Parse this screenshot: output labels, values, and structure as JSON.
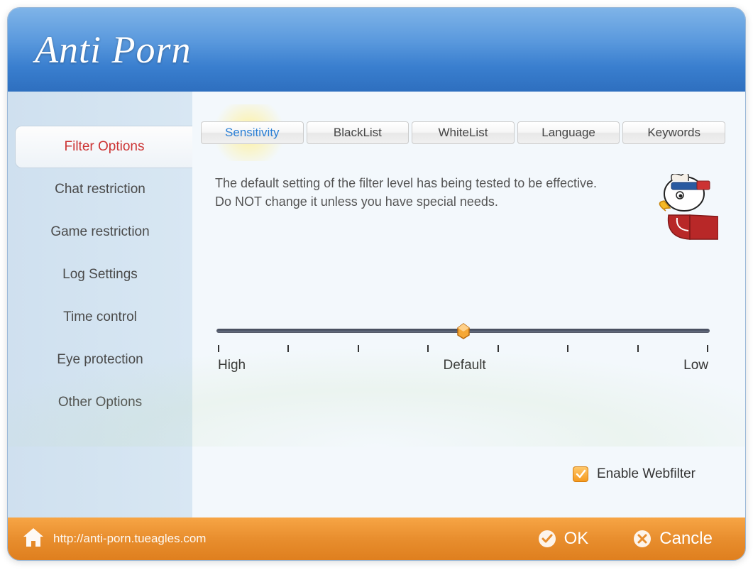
{
  "app": {
    "title": "Anti Porn"
  },
  "sidebar": {
    "items": [
      {
        "label": "Filter Options",
        "active": true
      },
      {
        "label": "Chat restriction",
        "active": false
      },
      {
        "label": "Game restriction",
        "active": false
      },
      {
        "label": "Log Settings",
        "active": false
      },
      {
        "label": "Time control",
        "active": false
      },
      {
        "label": "Eye protection",
        "active": false
      },
      {
        "label": "Other Options",
        "active": false
      }
    ]
  },
  "tabs": [
    {
      "label": "Sensitivity",
      "active": true
    },
    {
      "label": "BlackList",
      "active": false
    },
    {
      "label": "WhiteList",
      "active": false
    },
    {
      "label": "Language",
      "active": false
    },
    {
      "label": "Keywords",
      "active": false
    }
  ],
  "panel": {
    "description": "The default setting of the filter level has being tested to be effective. Do NOT change it unless you have special needs.",
    "slider": {
      "ticks": 8,
      "value": 4,
      "labels": {
        "left": "High",
        "mid": "Default",
        "right": "Low"
      }
    },
    "checkbox": {
      "checked": true,
      "label": "Enable Webfilter"
    },
    "mascot": "eagle-mascot"
  },
  "footer": {
    "url": "http://anti-porn.tueagles.com",
    "ok": "OK",
    "cancel": "Cancle"
  }
}
